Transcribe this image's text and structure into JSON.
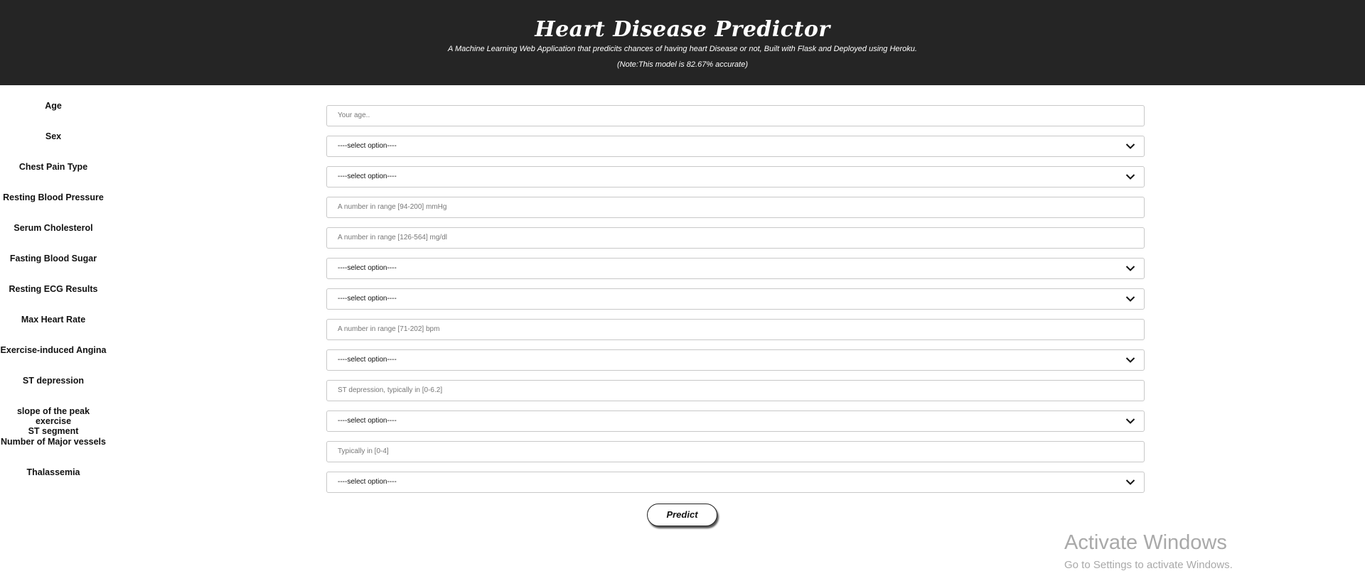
{
  "header": {
    "title": "Heart Disease Predictor",
    "subtitle": "A Machine Learning Web Application that predicits chances of having heart Disease or not, Built with Flask and Deployed using Heroku.",
    "note": "(Note:This model is 82.67% accurate)",
    "background": "#252525"
  },
  "form": {
    "fields": [
      {
        "label": "Age",
        "type": "input",
        "placeholder": "Your age.."
      },
      {
        "label": "Sex",
        "type": "select",
        "value": "----select option----"
      },
      {
        "label": "Chest Pain Type",
        "type": "select",
        "value": "----select option----"
      },
      {
        "label": "Resting Blood Pressure",
        "type": "input",
        "placeholder": "A number in range [94-200] mmHg"
      },
      {
        "label": "Serum Cholesterol",
        "type": "input",
        "placeholder": "A number in range [126-564] mg/dl"
      },
      {
        "label": "Fasting Blood Sugar",
        "type": "select",
        "value": "----select option----"
      },
      {
        "label": "Resting ECG Results",
        "type": "select",
        "value": "----select option----"
      },
      {
        "label": "Max Heart Rate",
        "type": "input",
        "placeholder": "A number in range [71-202] bpm"
      },
      {
        "label": "Exercise-induced Angina",
        "type": "select",
        "value": "----select option----"
      },
      {
        "label": "ST depression",
        "type": "input",
        "placeholder": "ST depression, typically in [0-6.2]"
      },
      {
        "label_line1": "slope of the peak exercise",
        "label_line2": "ST segment",
        "type": "select",
        "value": "----select option----"
      },
      {
        "label": "Number of Major vessels",
        "type": "input",
        "placeholder": "Typically in [0-4]"
      },
      {
        "label": "Thalassemia",
        "type": "select",
        "value": "----select option----"
      }
    ],
    "submit_label": "Predict"
  },
  "watermark": {
    "line1": "Activate Windows",
    "line2": "Go to Settings to activate Windows."
  }
}
